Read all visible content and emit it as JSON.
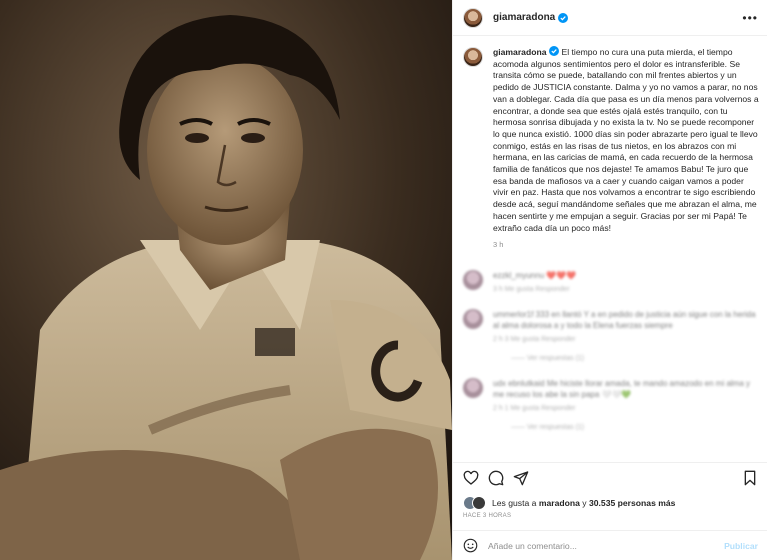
{
  "post": {
    "author": "giamaradona",
    "more_label": "•••",
    "caption": "El tiempo no cura una puta mierda, el tiempo acomoda algunos sentimientos pero el dolor es intransferible. Se transita cómo se puede, batallando con mil frentes abiertos y un pedido de JUSTICIA constante. Dalma y yo no vamos a parar, no nos van a doblegar. Cada día que pasa es un día menos para volvernos a encontrar, a donde sea que estés ojalá estés tranquilo, con tu hermosa sonrisa dibujada y no exista la tv. No se puede recomponer lo que nunca existió. 1000 días sin poder abrazarte pero igual te llevo conmigo, estás en las risas de tus nietos, en los abrazos con mi hermana, en las caricias de mamá, en cada recuerdo de la hermosa familia de fanáticos que nos dejaste! Te amamos Babu! Te juro que esa banda de mafiosos va a caer y cuando caigan vamos a poder vivir en paz. Hasta que nos volvamos a encontrar te sigo escribiendo desde acá, seguí mandándome señales que me abrazan el alma, me hacen sentirte y me empujan a seguir. Gracias por ser mi Papá! Te extraño cada día un poco más!",
    "time_ago": "3 h"
  },
  "comments": [
    {
      "text": "ezzkl_myunnu ❤️❤️❤️",
      "meta": "3 h   Me gusta   Responder"
    },
    {
      "text": "ummerlor1f 333 en llantó Y a en pedido de justicia aún sigue con la herida al alma dolorosa a y todo la Elena fuerzas siempre",
      "meta": "2 h   3 Me gusta   Responder",
      "replies": "—— Ver respuestas (1)"
    },
    {
      "text": "udx ebnlutkaid Me hiciste llorar amada, te mando amazodo en mi alma y me recuso los abe la sin papa 🤍🤍💚",
      "meta": "2 h   1 Me gusta   Responder",
      "replies": "—— Ver respuestas (1)"
    }
  ],
  "actions": {
    "like": "heart-icon",
    "comment": "comment-icon",
    "share": "share-icon",
    "save": "bookmark-icon"
  },
  "likes": {
    "prefix": "Les gusta a",
    "first_user": "maradona",
    "middle": "y",
    "others": "30.535 personas más"
  },
  "posted": "HACE 3 HORAS",
  "comment_box": {
    "placeholder": "Añade un comentario...",
    "publish_label": "Publicar"
  },
  "colors": {
    "verified": "#0095f6",
    "publish_disabled": "#b2dffc",
    "muted": "#8e8e8e"
  }
}
